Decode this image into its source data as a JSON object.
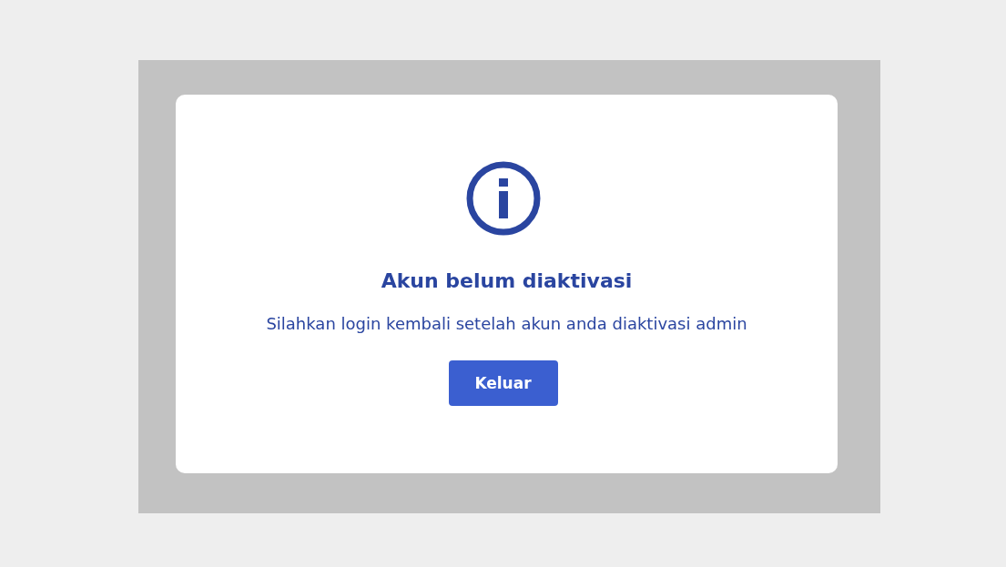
{
  "dialog": {
    "title": "Akun belum diaktivasi",
    "message": "Silahkan login kembali setelah akun anda diaktivasi admin",
    "buttons": [
      "Keluar"
    ]
  }
}
